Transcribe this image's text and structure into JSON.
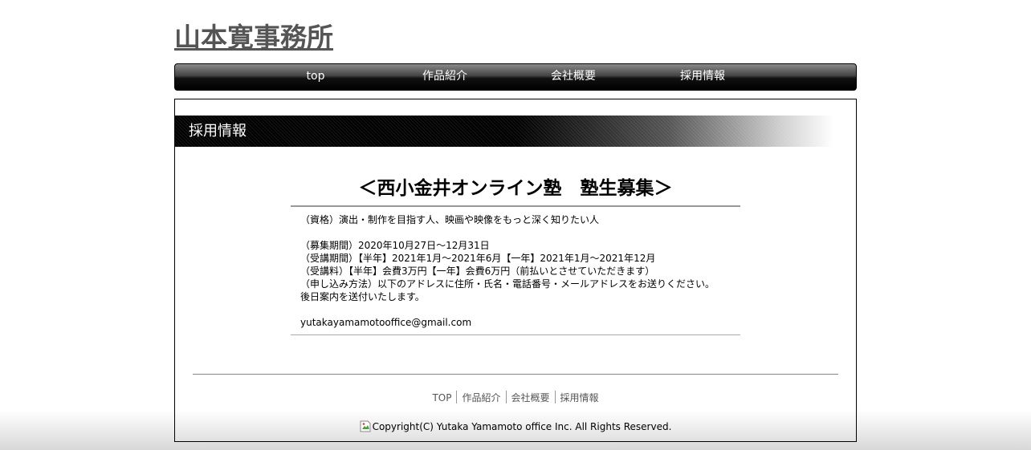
{
  "site": {
    "title": "山本寛事務所"
  },
  "nav": {
    "items": [
      {
        "label": "top"
      },
      {
        "label": "作品紹介"
      },
      {
        "label": "会社概要"
      },
      {
        "label": "採用情報"
      }
    ]
  },
  "section": {
    "title": "採用情報"
  },
  "article": {
    "title": "＜西小金井オンライン塾　塾生募集＞",
    "lines": [
      "（資格）演出・制作を目指す人、映画や映像をもっと深く知りたい人",
      "",
      "（募集期間）2020年10月27日～12月31日",
      "（受講期間）【半年】2021年1月～2021年6月【一年】2021年1月～2021年12月",
      "（受講料）【半年】会費3万円【一年】会費6万円（前払いとさせていただきます）",
      "（申し込み方法）以下のアドレスに住所・氏名・電話番号・メールアドレスをお送りください。",
      "後日案内を送付いたします。",
      ""
    ],
    "email": "yutakayamamotooffice@gmail.com"
  },
  "footer": {
    "links": [
      {
        "label": "TOP"
      },
      {
        "label": "作品紹介"
      },
      {
        "label": "会社概要"
      },
      {
        "label": "採用情報"
      }
    ],
    "copyright": "Copyright(C) Yutaka Yamamoto office Inc. All Rights Reserved."
  },
  "colors": {
    "title": "#555555",
    "nav_text": "#ffffff",
    "footer_link": "#555555"
  }
}
